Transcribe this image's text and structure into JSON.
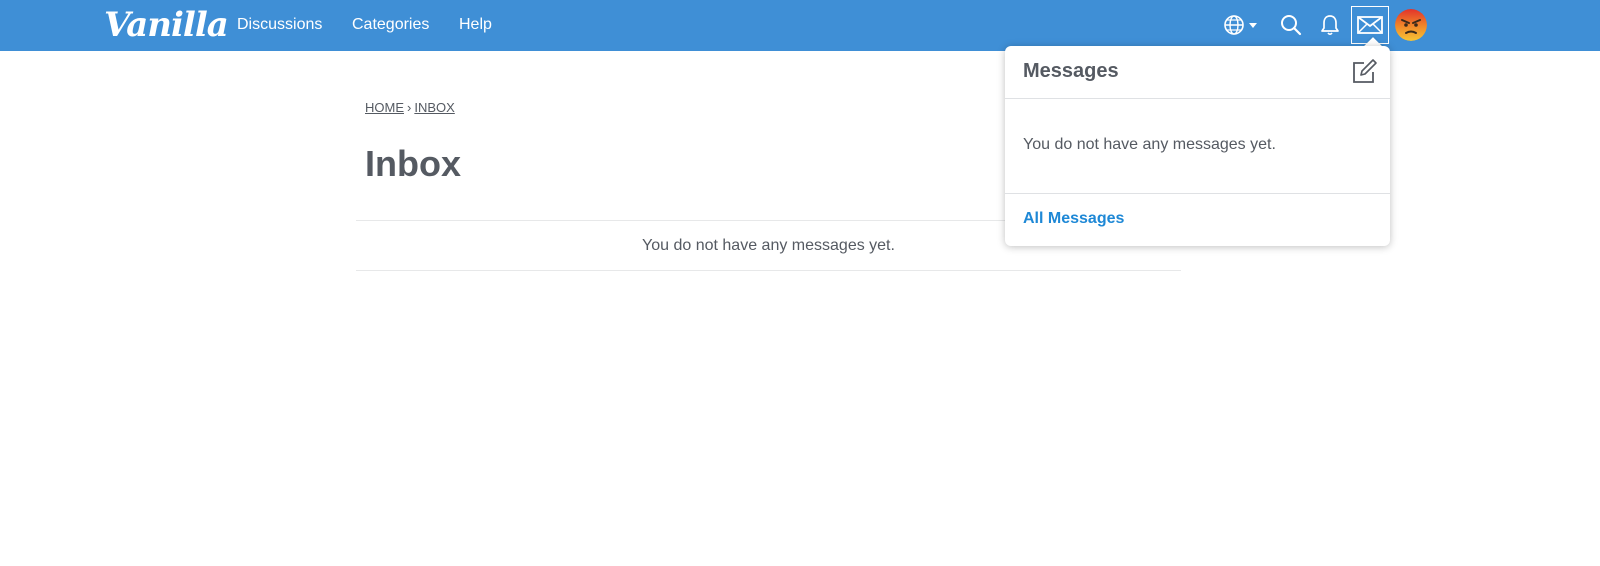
{
  "header": {
    "logo_text": "Vanilla",
    "nav": [
      {
        "label": "Discussions"
      },
      {
        "label": "Categories"
      },
      {
        "label": "Help"
      }
    ],
    "icons": [
      "globe-icon",
      "search-icon",
      "bell-icon",
      "envelope-icon",
      "avatar"
    ]
  },
  "breadcrumb": {
    "home": "HOME",
    "separator": "›",
    "current": "INBOX"
  },
  "main": {
    "title": "Inbox",
    "empty_message": "You do not have any messages yet."
  },
  "messages_dropdown": {
    "title": "Messages",
    "empty_message": "You do not have any messages yet.",
    "footer_link": "All Messages"
  },
  "colors": {
    "topbar": "#3f8fd6",
    "link": "#1e88d6",
    "text": "#555a62"
  }
}
